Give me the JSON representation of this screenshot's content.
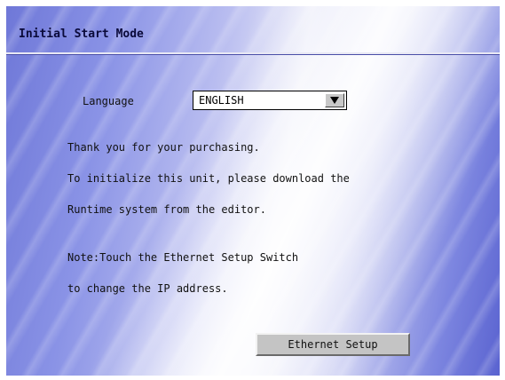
{
  "header": {
    "title": "Initial Start Mode"
  },
  "language": {
    "label": "Language",
    "selected": "ENGLISH"
  },
  "messages": [
    "Thank you for your purchasing.",
    "To initialize this unit, please download the",
    "Runtime system from the editor.",
    "Note:Touch the Ethernet Setup Switch",
    "to change the IP address."
  ],
  "buttons": {
    "ethernet_setup": "Ethernet Setup"
  },
  "icons": {
    "dropdown": "triangle-down-icon"
  },
  "colors": {
    "background_blue": "#6f78d8",
    "title_text": "#0a0a3a",
    "button_gray": "#c4c4c4"
  }
}
